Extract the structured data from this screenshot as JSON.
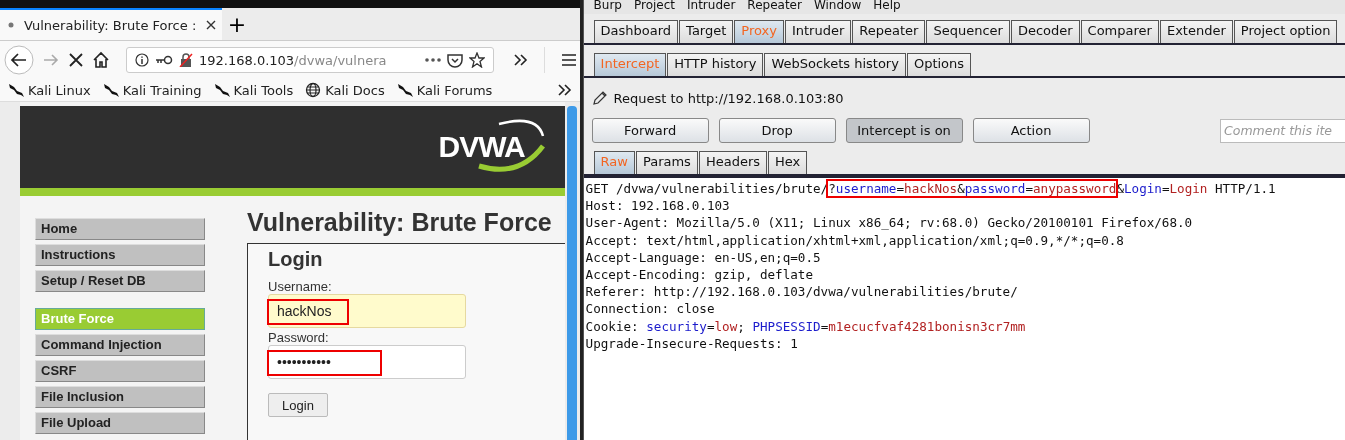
{
  "browser": {
    "tab": {
      "title": "Vulnerability: Brute Force :",
      "selected": true
    },
    "new_tab": "+",
    "url": {
      "host": "192.168.0.103",
      "path": "/dvwa/vulnera"
    },
    "bookmarks": [
      {
        "label": "Kali Linux",
        "kind": "kali"
      },
      {
        "label": "Kali Training",
        "kind": "kali"
      },
      {
        "label": "Kali Tools",
        "kind": "kali"
      },
      {
        "label": "Kali Docs",
        "kind": "globe"
      },
      {
        "label": "Kali Forums",
        "kind": "kali"
      }
    ],
    "page": {
      "logo": "DVWA",
      "menu_groups": [
        [
          {
            "label": "Home",
            "selected": false
          },
          {
            "label": "Instructions",
            "selected": false
          },
          {
            "label": "Setup / Reset DB",
            "selected": false
          }
        ],
        [
          {
            "label": "Brute Force",
            "selected": true
          },
          {
            "label": "Command Injection",
            "selected": false
          },
          {
            "label": "CSRF",
            "selected": false
          },
          {
            "label": "File Inclusion",
            "selected": false
          },
          {
            "label": "File Upload",
            "selected": false
          }
        ]
      ],
      "heading": "Vulnerability: Brute Force",
      "form": {
        "title": "Login",
        "fields": [
          {
            "label": "Username:",
            "value": "hackNos",
            "autofilled": true,
            "annotated": true
          },
          {
            "label": "Password:",
            "value": "•••••••••••",
            "autofilled": false,
            "annotated": true
          }
        ],
        "button": "Login"
      }
    }
  },
  "burp": {
    "menu": [
      "Burp",
      "Project",
      "Intruder",
      "Repeater",
      "Window",
      "Help"
    ],
    "tabs": [
      {
        "label": "Dashboard",
        "selected": false
      },
      {
        "label": "Target",
        "selected": false
      },
      {
        "label": "Proxy",
        "selected": true
      },
      {
        "label": "Intruder",
        "selected": false
      },
      {
        "label": "Repeater",
        "selected": false
      },
      {
        "label": "Sequencer",
        "selected": false
      },
      {
        "label": "Decoder",
        "selected": false
      },
      {
        "label": "Comparer",
        "selected": false
      },
      {
        "label": "Extender",
        "selected": false
      },
      {
        "label": "Project option",
        "selected": false
      }
    ],
    "subtabs": [
      {
        "label": "Intercept",
        "selected": true
      },
      {
        "label": "HTTP history",
        "selected": false
      },
      {
        "label": "WebSockets history",
        "selected": false
      },
      {
        "label": "Options",
        "selected": false
      }
    ],
    "request_to": "Request to http://192.168.0.103:80",
    "buttons": [
      {
        "label": "Forward",
        "pressed": false
      },
      {
        "label": "Drop",
        "pressed": false
      },
      {
        "label": "Intercept is on",
        "pressed": true
      },
      {
        "label": "Action",
        "pressed": false
      }
    ],
    "comment": {
      "placeholder": "Comment this ite"
    },
    "editor_tabs": [
      {
        "label": "Raw",
        "selected": true
      },
      {
        "label": "Params",
        "selected": false
      },
      {
        "label": "Headers",
        "selected": false
      },
      {
        "label": "Hex",
        "selected": false
      }
    ],
    "lines": [
      [
        {
          "text": "GET /dvwa/vulnerabilities/brute/",
          "kind": "plain"
        },
        {
          "kind": "box",
          "segments": [
            {
              "text": "?",
              "kind": "plain"
            },
            {
              "text": "username",
              "kind": "name"
            },
            {
              "text": "=",
              "kind": "plain"
            },
            {
              "text": "hackNos",
              "kind": "value"
            },
            {
              "text": "&",
              "kind": "plain"
            },
            {
              "text": "password",
              "kind": "name"
            },
            {
              "text": "=",
              "kind": "plain"
            },
            {
              "text": "anypassword",
              "kind": "value"
            }
          ]
        },
        {
          "text": "&",
          "kind": "plain"
        },
        {
          "text": "Login",
          "kind": "name"
        },
        {
          "text": "=",
          "kind": "plain"
        },
        {
          "text": "Login",
          "kind": "value"
        },
        {
          "text": " HTTP/1.1",
          "kind": "plain"
        }
      ],
      [
        {
          "text": "Host: 192.168.0.103",
          "kind": "plain"
        }
      ],
      [
        {
          "text": "User-Agent: Mozilla/5.0 (X11; Linux x86_64; rv:68.0) Gecko/20100101 Firefox/68.0",
          "kind": "plain"
        }
      ],
      [
        {
          "text": "Accept: text/html,application/xhtml+xml,application/xml;q=0.9,*/*;q=0.8",
          "kind": "plain"
        }
      ],
      [
        {
          "text": "Accept-Language: en-US,en;q=0.5",
          "kind": "plain"
        }
      ],
      [
        {
          "text": "Accept-Encoding: gzip, deflate",
          "kind": "plain"
        }
      ],
      [
        {
          "text": "Referer: http://192.168.0.103/dvwa/vulnerabilities/brute/",
          "kind": "plain"
        }
      ],
      [
        {
          "text": "Connection: close",
          "kind": "plain"
        }
      ],
      [
        {
          "text": "Cookie: ",
          "kind": "plain"
        },
        {
          "text": "security",
          "kind": "name"
        },
        {
          "text": "=",
          "kind": "plain"
        },
        {
          "text": "low",
          "kind": "value"
        },
        {
          "text": "; ",
          "kind": "plain"
        },
        {
          "text": "PHPSESSID",
          "kind": "name"
        },
        {
          "text": "=",
          "kind": "plain"
        },
        {
          "text": "m1ecucfvaf4281bonisn3cr7mm",
          "kind": "value"
        }
      ],
      [
        {
          "text": "Upgrade-Insecure-Requests: 1",
          "kind": "plain"
        }
      ]
    ]
  }
}
